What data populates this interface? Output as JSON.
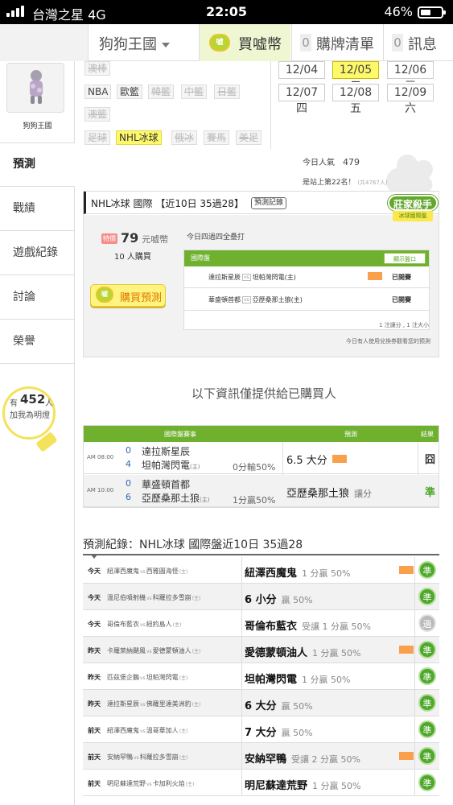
{
  "status_bar": {
    "carrier": "台灣之星",
    "network": "4G",
    "time": "22:05",
    "battery": "46%"
  },
  "top_nav": {
    "site_name": "狗狗王國",
    "buy_coin_label": "買嘘幣",
    "buy_list_count": "0",
    "buy_list_label": "購牌清單",
    "messages_count": "0",
    "messages_label": "訊息",
    "coin_icon_text": "噓"
  },
  "sidebar": {
    "site_name": "狗狗王國",
    "items": [
      {
        "label": "預測"
      },
      {
        "label": "戰績"
      },
      {
        "label": "遊戲紀錄"
      },
      {
        "label": "討論"
      },
      {
        "label": "榮譽"
      }
    ],
    "bulb": {
      "prefix": "有",
      "count": "452",
      "suffix": "人",
      "text": "加我為明燈"
    }
  },
  "sport_tags": {
    "row1": [
      "澳棒"
    ],
    "row2": [
      "NBA",
      "歐籃",
      "韓籃",
      "中籃",
      "日籃"
    ],
    "row3": [
      "澳籃"
    ],
    "row4": [
      "足球",
      "NHL冰球",
      "俄冰",
      "賽馬",
      "美足"
    ]
  },
  "dates": [
    "12/04 一",
    "12/05 二",
    "12/06 三",
    "12/07 四",
    "12/08 五",
    "12/09 六"
  ],
  "popularity": {
    "label": "今日人氣",
    "value": "479",
    "rank_text": "是站上第22名！",
    "rank_small": "(共4767人)"
  },
  "prediction": {
    "title": "NHL冰球 國際 【近10日 35過28】",
    "record_button": "預測記錄",
    "badge_top": "莊家殺手",
    "badge_bottom": "冰球國際盤",
    "ticket": "特價",
    "price": "79",
    "price_unit": "元嘘幣",
    "buyers": "10 人購買",
    "buy_button": "購買預測",
    "intro": "今日四過四全壘打",
    "panel_title": "國際盤",
    "panel_button": "顯示盤口",
    "matches": [
      {
        "away": "達拉斯星辰",
        "home": "坦帕灣閃電(主)",
        "status": "已開賽"
      },
      {
        "away": "華盛頓首都",
        "home": "亞歷桑那土狼(主)",
        "status": "已開賽"
      }
    ],
    "note1": "1 注讓分 , 1 注大小",
    "note2": "今日有人使用兌換券觀看您的預測"
  },
  "info_text": "以下資訊僅提供給已購買人",
  "results": {
    "headers": [
      "國際盤賽事",
      "預測",
      "結果"
    ],
    "rows": [
      {
        "time": "AM 08:00",
        "s1": "0",
        "t1": "達拉斯星辰",
        "s2": "4",
        "t2": "坦帕灣閃電",
        "odds": "0分輸50%",
        "pick": "6.5 大分",
        "pick_note": "",
        "result": "囧",
        "result_color": "#333333"
      },
      {
        "time": "AM 10:00",
        "s1": "0",
        "t1": "華盛頓首都",
        "s2": "6",
        "t2": "亞歷桑那土狼",
        "odds": "1分贏50%",
        "pick": "亞歷桑那土狼",
        "pick_note": "讓分",
        "result": "準",
        "result_color": "#4ea82c"
      }
    ]
  },
  "records": {
    "title": "預測紀錄：NHL冰球 國際盤近10日 35過28",
    "vs": "vs",
    "home_mark": "(主)",
    "rows": [
      {
        "day": "今天",
        "team1": "紐澤西魔鬼",
        "team2": "西雅圖海怪",
        "pick": "紐澤西魔鬼",
        "odds": "1 分贏 50%",
        "hot": true,
        "result": "準",
        "grey": false
      },
      {
        "day": "今天",
        "team1": "溫尼伯噴射機",
        "team2": "科羅拉多雪崩",
        "pick": "6 小分",
        "odds": "贏 50%",
        "hot": false,
        "result": "準",
        "grey": false
      },
      {
        "day": "今天",
        "team1": "哥倫布藍衣",
        "team2": "紐約島人",
        "pick": "哥倫布藍衣",
        "odds": "受讓 1 分贏 50%",
        "hot": false,
        "result": "過",
        "grey": true
      },
      {
        "day": "昨天",
        "team1": "卡羅萊納颶風",
        "team2": "愛德蒙頓油人",
        "pick": "愛德蒙頓油人",
        "odds": "1 分贏 50%",
        "hot": true,
        "result": "準",
        "grey": false
      },
      {
        "day": "昨天",
        "team1": "匹茲堡企鵝",
        "team2": "坦帕灣閃電",
        "pick": "坦帕灣閃電",
        "odds": "1 分贏 50%",
        "hot": false,
        "result": "準",
        "grey": false
      },
      {
        "day": "昨天",
        "team1": "達拉斯星辰",
        "team2": "佛羅里達美洲豹",
        "pick": "6 大分",
        "odds": "贏 50%",
        "hot": false,
        "result": "準",
        "grey": false
      },
      {
        "day": "前天",
        "team1": "紐澤西魔鬼",
        "team2": "溫哥華加人",
        "pick": "7 大分",
        "odds": "贏 50%",
        "hot": false,
        "result": "準",
        "grey": false
      },
      {
        "day": "前天",
        "team1": "安納罕鴨",
        "team2": "科羅拉多雪崩",
        "pick": "安納罕鴨",
        "odds": "受讓 2 分贏 50%",
        "hot": true,
        "result": "準",
        "grey": false
      },
      {
        "day": "前天",
        "team1": "明尼蘇達荒野",
        "team2": "卡加利火焰",
        "pick": "明尼蘇達荒野",
        "odds": "1 分贏 50%",
        "hot": false,
        "result": "準",
        "grey": false
      }
    ]
  },
  "colors": {
    "accent_green": "#6fb02e",
    "selected_yellow": "#fef96a",
    "hot_orange": "#f8a04c"
  }
}
